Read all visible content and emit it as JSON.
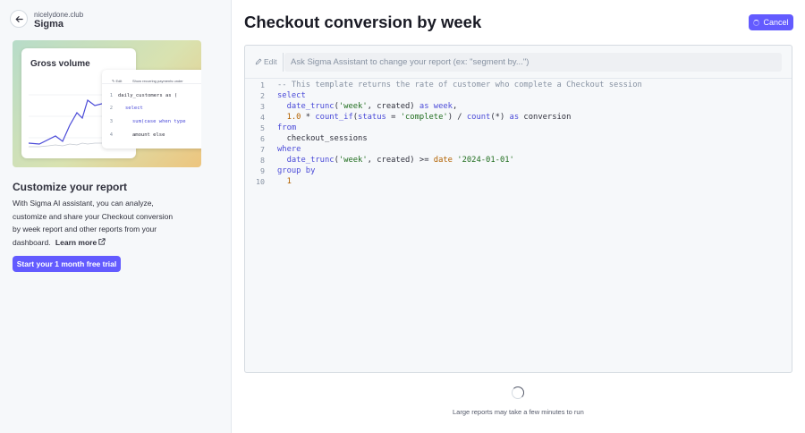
{
  "account": {
    "domain": "nicelydone.club",
    "name": "Sigma"
  },
  "hero": {
    "card_title": "Gross volume",
    "mini_edit": "Edit",
    "mini_ask": "Show recurring payments under",
    "mini_code": [
      {
        "n": "1",
        "text": "daily_customers  as  ("
      },
      {
        "n": "2",
        "text": "select"
      },
      {
        "n": "3",
        "text": "sum(case  when  type"
      },
      {
        "n": "4",
        "text": "amount  else"
      }
    ]
  },
  "promo": {
    "title": "Customize your report",
    "description": "With Sigma AI assistant, you can analyze, customize and share your Checkout conversion by week report and other reports from your dashboard.",
    "learn_more": "Learn more",
    "cta": "Start your 1 month free trial"
  },
  "header": {
    "title": "Checkout conversion by week",
    "cancel_label": "Cancel"
  },
  "editor": {
    "edit_label": "Edit",
    "ask_placeholder": "Ask Sigma Assistant to change your report (ex: \"segment by...\")",
    "lines": [
      "1",
      "2",
      "3",
      "4",
      "5",
      "6",
      "7",
      "8",
      "9",
      "10"
    ],
    "code": [
      [
        [
          "c-com",
          "-- This template returns the rate of customer who complete a Checkout session"
        ]
      ],
      [
        [
          "c-kw",
          "select"
        ]
      ],
      [
        [
          "",
          "  "
        ],
        [
          "c-fn",
          "date_trunc"
        ],
        [
          "",
          "("
        ],
        [
          "c-str",
          "'week'"
        ],
        [
          "",
          ", created) "
        ],
        [
          "c-kw",
          "as"
        ],
        [
          "",
          " "
        ],
        [
          "c-kw",
          "week"
        ],
        [
          "",
          ","
        ]
      ],
      [
        [
          "",
          "  "
        ],
        [
          "c-num",
          "1.0"
        ],
        [
          "",
          " * "
        ],
        [
          "c-fn",
          "count_if"
        ],
        [
          "",
          "("
        ],
        [
          "c-kw",
          "status"
        ],
        [
          "",
          " = "
        ],
        [
          "c-str",
          "'complete'"
        ],
        [
          "",
          ") / "
        ],
        [
          "c-fn",
          "count"
        ],
        [
          "",
          "(*) "
        ],
        [
          "c-kw",
          "as"
        ],
        [
          "",
          " conversion"
        ]
      ],
      [
        [
          "c-kw",
          "from"
        ]
      ],
      [
        [
          "",
          "  checkout_sessions"
        ]
      ],
      [
        [
          "c-kw",
          "where"
        ]
      ],
      [
        [
          "",
          "  "
        ],
        [
          "c-fn",
          "date_trunc"
        ],
        [
          "",
          "("
        ],
        [
          "c-str",
          "'week'"
        ],
        [
          "",
          ", created) >= "
        ],
        [
          "c-num",
          "date"
        ],
        [
          "",
          " "
        ],
        [
          "c-str",
          "'2024-01-01'"
        ]
      ],
      [
        [
          "c-kw",
          "group by"
        ]
      ],
      [
        [
          "",
          "  "
        ],
        [
          "c-num",
          "1"
        ]
      ]
    ]
  },
  "status": {
    "note": "Large reports may take a few minutes to run"
  }
}
